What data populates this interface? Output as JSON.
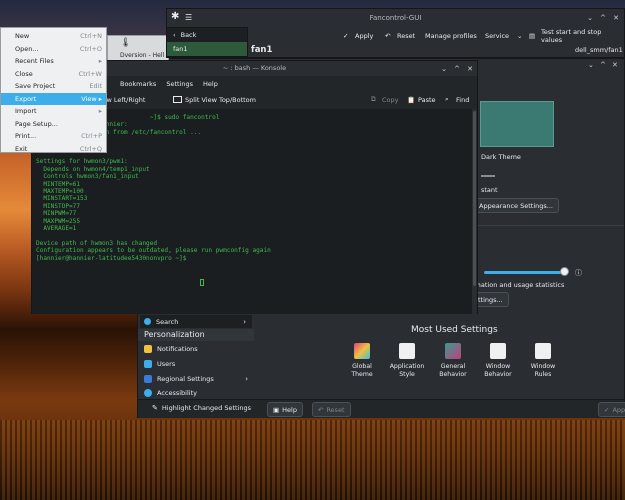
{
  "fancontrol": {
    "title": "Fancontrol-GUI",
    "apply": "Apply",
    "reset": "Reset",
    "manage_profiles": "Manage profiles",
    "service": "Service",
    "test": "Test start and stop values",
    "page_title": "fan1",
    "right_label": "dell_smm/fan1",
    "nav_back": "Back",
    "nav_item": "fan1"
  },
  "filemenu": {
    "items": [
      {
        "label": "New",
        "shortcut": "Ctrl+N"
      },
      {
        "label": "Open...",
        "shortcut": "Ctrl+O"
      },
      {
        "label": "Recent Files",
        "shortcut": "▸"
      },
      {
        "label": "Close",
        "shortcut": "Ctrl+W"
      },
      {
        "label": "Save Project",
        "shortcut": "Edit"
      },
      {
        "label": "Export",
        "shortcut": "View ▸"
      },
      {
        "label": "Import",
        "shortcut": "▸"
      },
      {
        "label": "Page Setup...",
        "shortcut": ""
      },
      {
        "label": "Print...",
        "shortcut": "Ctrl+P"
      },
      {
        "label": "Exit",
        "shortcut": "Ctrl+Q"
      }
    ],
    "highlighted": "Export"
  },
  "konsole": {
    "title": "~ : bash — Konsole",
    "menu": [
      "Bookmarks",
      "Settings",
      "Help"
    ],
    "split_lr": "it View Left/Right",
    "split_tb": "Split View Top/Bottom",
    "copy": "Copy",
    "paste": "Paste",
    "find": "Find",
    "terminal": "                               ~]$ sudo fancontrol\n                 hannier:\n       configuration from /etc/fancontrol ...\n\n     INTERVAL=10\n\nSettings for hwmon3/pwm1:\n  Depends on hwmon4/temp1_input\n  Controls hwmon3/fan1_input\n  MINTEMP=61\n  MAXTEMP=100\n  MINSTART=153\n  MINSTOP=77\n  MINPWM=77\n  MAXPWM=255\n  AVERAGE=1\n\nDevice path of hwmon3 has changed\nConfiguration appears to be outdated, please run pwmconfig again\n[hannier@hannier-latitudee5430nonvpro ~]$ "
  },
  "settings": {
    "dark_theme": "Dark Theme",
    "stant": "stant",
    "appearance_btn": "Appearance Settings...",
    "usage_text": "rmation and usage statistics",
    "settings_btn": "ettings...",
    "search": "Search",
    "personalization": "Personalization",
    "sidebar": [
      "Notifications",
      "Users",
      "Regional Settings",
      "Accessibility"
    ],
    "most_used": "Most Used Settings",
    "tiles": [
      {
        "label": "Global Theme"
      },
      {
        "label": "Application Style"
      },
      {
        "label": "General Behavior"
      },
      {
        "label": "Window Behavior"
      },
      {
        "label": "Window Rules"
      }
    ],
    "highlight": "Highlight Changed Settings",
    "help": "Help",
    "reset": "Reset",
    "apply": "App"
  },
  "background_window": {
    "label": "Dversion - Hell"
  }
}
